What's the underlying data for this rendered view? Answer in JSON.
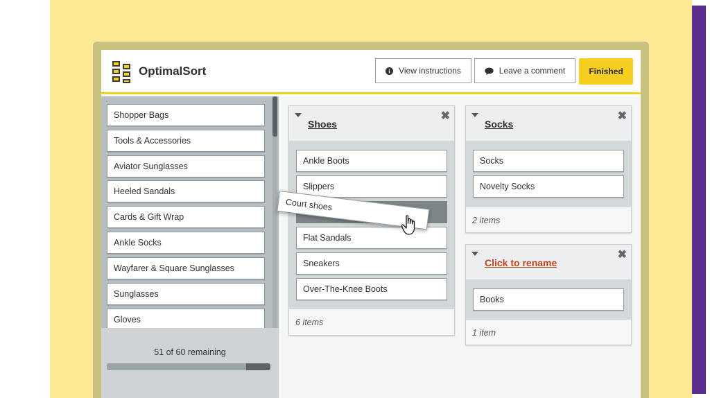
{
  "app": {
    "name": "OptimalSort",
    "logo_icon": "card-grid-icon",
    "accent_color": "#f3d21c"
  },
  "header": {
    "view_instructions": "View instructions",
    "leave_comment": "Leave a comment",
    "finished": "Finished"
  },
  "sidebar": {
    "cards": [
      "Shopper Bags",
      "Tools & Accessories",
      "Aviator Sunglasses",
      "Heeled Sandals",
      "Cards & Gift Wrap",
      "Ankle Socks",
      "Wayfarer & Square Sunglasses",
      "Sunglasses",
      "Gloves"
    ],
    "remaining_text": "51 of 60 remaining",
    "sorted_fraction": 0.85
  },
  "groups": {
    "shoes": {
      "title": "Shoes",
      "cards": [
        "Ankle Boots",
        "Slippers",
        "Flat Sandals",
        "Sneakers",
        "Over-The-Knee Boots"
      ],
      "count": "6 items"
    },
    "socks": {
      "title": "Socks",
      "cards": [
        "Socks",
        "Novelty Socks"
      ],
      "count": "2 items"
    },
    "unnamed": {
      "title": "Click to rename",
      "cards": [
        "Books"
      ],
      "count": "1 item"
    }
  },
  "dragging": {
    "label": "Court shoes"
  }
}
